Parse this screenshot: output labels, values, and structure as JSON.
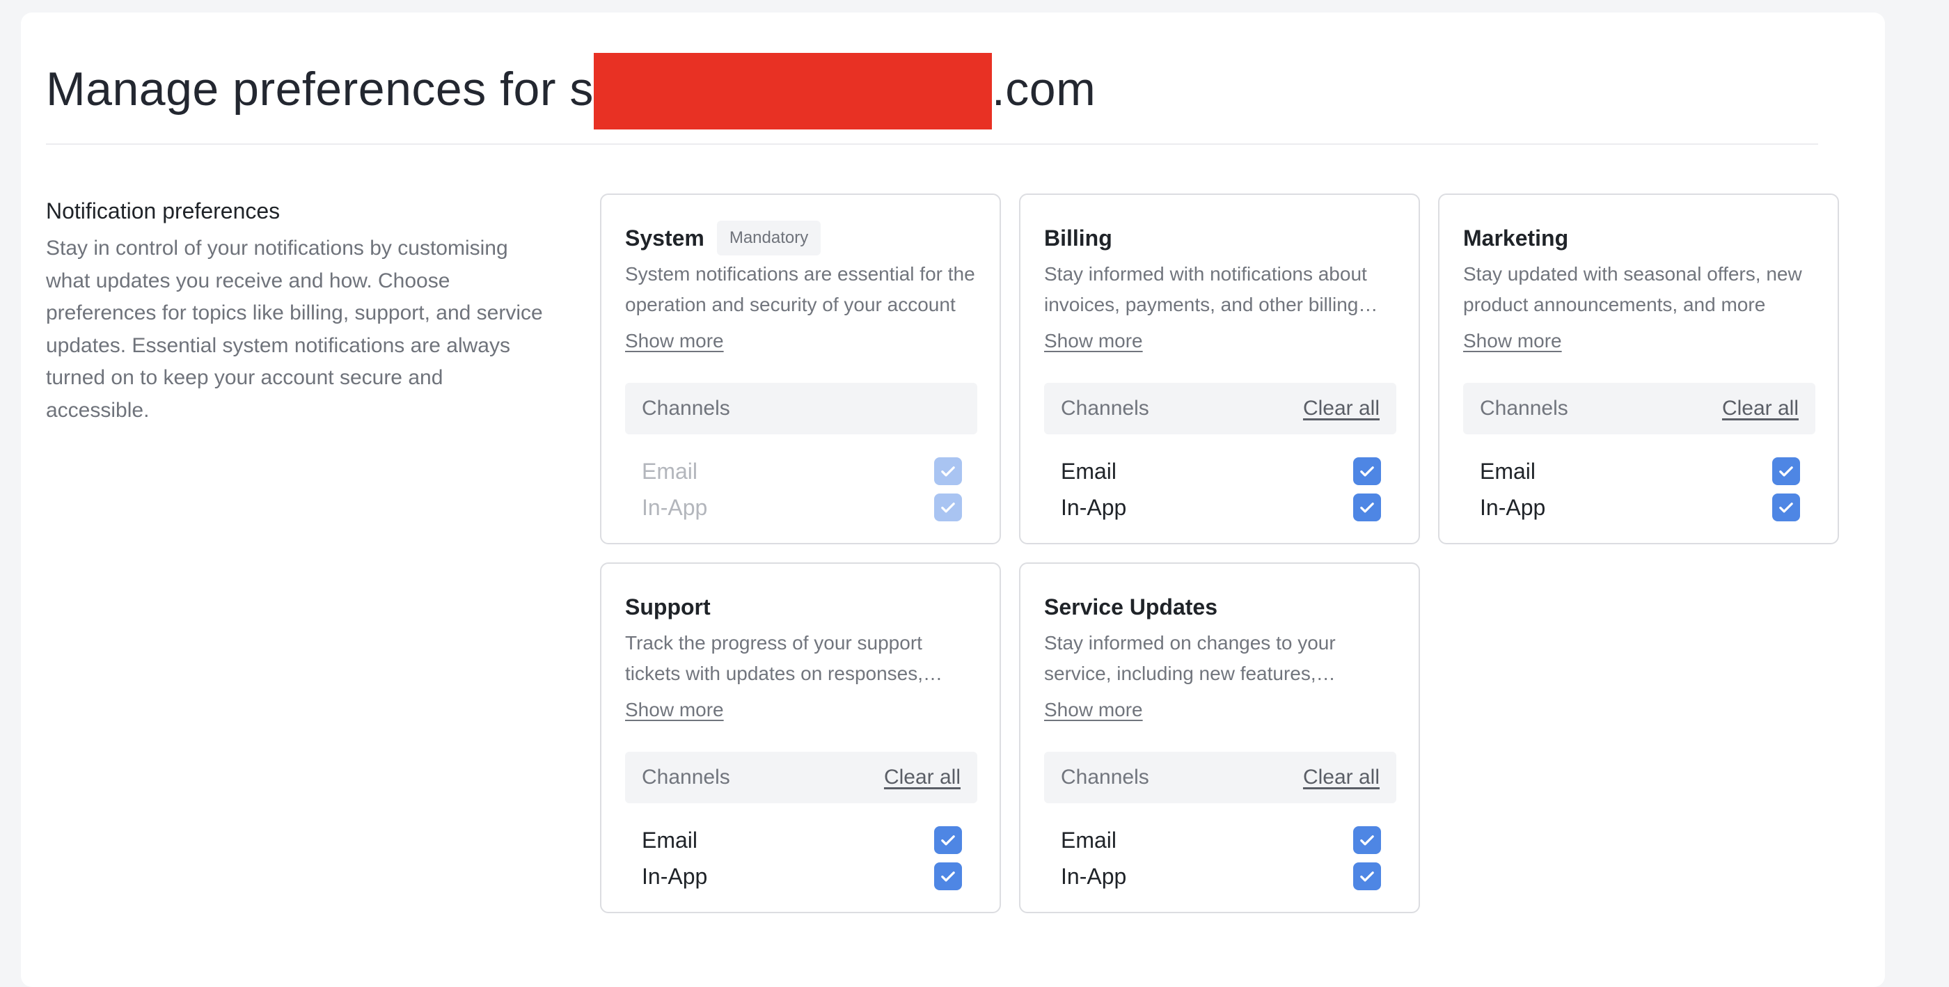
{
  "page": {
    "title_prefix": "Manage preferences for s",
    "title_suffix": ".com"
  },
  "intro": {
    "heading": "Notification preferences",
    "text": "Stay in control of your notifications by customising what updates you receive and how. Choose preferences for topics like billing, support, and service updates. Essential system notifications are always turned on to keep your account secure and accessible."
  },
  "labels": {
    "show_more": "Show more",
    "channels": "Channels",
    "clear_all": "Clear all",
    "email": "Email",
    "in_app": "In-App"
  },
  "cards": [
    {
      "title": "System",
      "badge": "Mandatory",
      "description": "System notifications are essential for the operation and security of your account",
      "email_checked": true,
      "in_app_checked": true,
      "disabled": true
    },
    {
      "title": "Billing",
      "description": "Stay informed with notifications about invoices, payments, and other billing updates",
      "email_checked": true,
      "in_app_checked": true,
      "disabled": false
    },
    {
      "title": "Marketing",
      "description": "Stay updated with seasonal offers, new product announcements, and more",
      "email_checked": true,
      "in_app_checked": true,
      "disabled": false
    },
    {
      "title": "Support",
      "description": "Track the progress of your support tickets with updates on responses, resolutions and more",
      "email_checked": true,
      "in_app_checked": true,
      "disabled": false
    },
    {
      "title": "Service Updates",
      "description": "Stay informed on changes to your service, including new features, improvements and more",
      "email_checked": true,
      "in_app_checked": true,
      "disabled": false
    }
  ],
  "colors": {
    "checkbox_active": "#4e86e4",
    "checkbox_disabled": "#a9c4f2",
    "redaction": "#e83124"
  }
}
